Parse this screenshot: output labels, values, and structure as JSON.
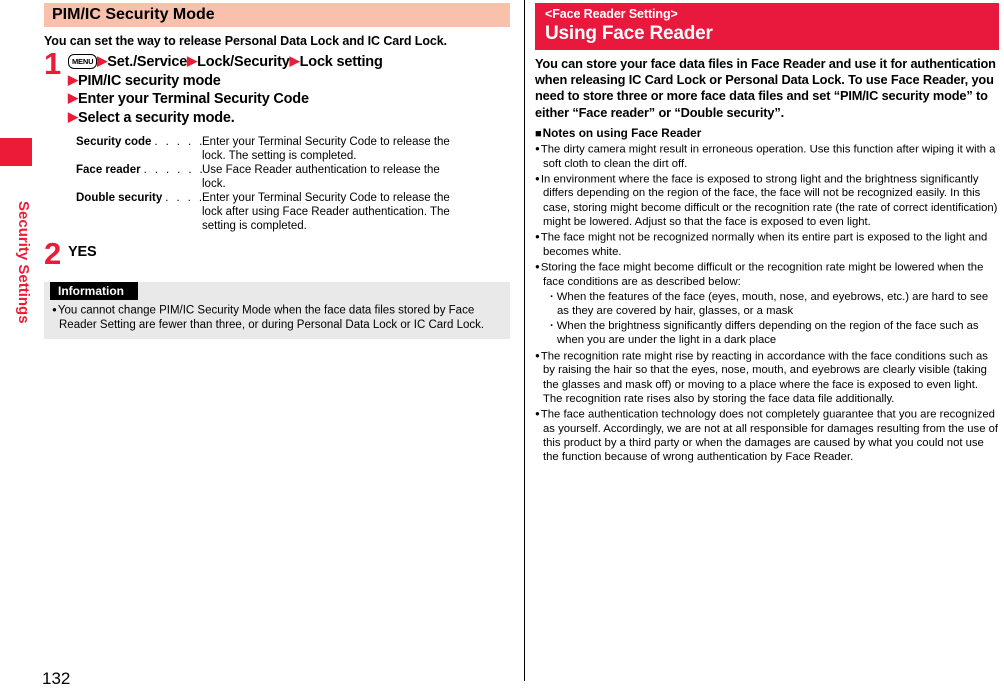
{
  "page": {
    "number": "132",
    "side_tab_label": "Security Settings",
    "accent_red": "#ec1c38",
    "header_red": "#e8193c",
    "header_peach": "#f9c0ab",
    "info_gray": "#e9e9e9"
  },
  "left": {
    "title": "PIM/IC Security Mode",
    "lead": "You can set the way to release Personal Data Lock and IC Card Lock.",
    "steps": [
      {
        "number": "1",
        "lines": [
          {
            "key_icon": "MENU",
            "segments": [
              "Set./Service",
              "Lock/Security",
              "Lock setting"
            ]
          },
          {
            "segments": [
              "PIM/IC security mode"
            ]
          },
          {
            "segments": [
              "Enter your Terminal Security Code"
            ]
          },
          {
            "segments": [
              "Select a security mode."
            ]
          }
        ]
      },
      {
        "number": "2",
        "lines": [
          {
            "segments_plain": "YES"
          }
        ]
      }
    ],
    "step2_label": "YES",
    "definitions": [
      {
        "term": "Security code",
        "dots": ". . . . .",
        "desc": "Enter your Terminal Security Code to release the lock. The setting is completed."
      },
      {
        "term": "Face reader",
        "dots": ". . . . . . .",
        "desc": "Use Face Reader authentication to release the lock."
      },
      {
        "term": "Double security",
        "dots": ". . . .",
        "desc": "Enter your Terminal Security Code to release the lock after using Face Reader authentication. The setting is completed."
      }
    ],
    "information": {
      "tag": "Information",
      "items": [
        "You cannot change PIM/IC Security Mode when the face data files stored by Face Reader Setting are fewer than three, or during Personal Data Lock or IC Card Lock."
      ]
    }
  },
  "right": {
    "eyebrow": "<Face Reader Setting>",
    "heading": "Using Face Reader",
    "lead": "You can store your face data files in Face Reader and use it for authentication when releasing IC Card Lock or Personal Data Lock. To use Face Reader, you need to store three or more face data files and set “PIM/IC security mode” to either “Face reader” or “Double security”.",
    "notes_heading": "Notes on using Face Reader",
    "notes": [
      {
        "type": "bullet",
        "text": "The dirty camera might result in erroneous operation. Use this function after wiping it with a soft cloth to clean the dirt off."
      },
      {
        "type": "bullet",
        "text": "In environment where the face is exposed to strong light and the brightness significantly differs depending on the region of the face, the face will not be recognized easily. In this case, storing might become difficult or the recognition rate (the rate of correct identification) might be lowered. Adjust so that the face is exposed to even light."
      },
      {
        "type": "bullet",
        "text": "The face might not be recognized normally when its entire part is exposed to the light and becomes white."
      },
      {
        "type": "bullet",
        "text": "Storing the face might become difficult or the recognition rate might be lowered when the face conditions are as described below:"
      },
      {
        "type": "sub",
        "text": "When the features of the face (eyes, mouth, nose, and eyebrows, etc.) are hard to see as they are covered by hair, glasses, or a mask"
      },
      {
        "type": "sub",
        "text": "When the brightness significantly differs depending on the region of the face such as when you are under the light in a dark place"
      },
      {
        "type": "bullet",
        "text": "The recognition rate might rise by reacting in accordance with the face conditions such as by raising the hair so that the eyes, nose, mouth, and eyebrows are clearly visible (taking the glasses and mask off) or moving to a place where the face is exposed to even light. The recognition rate rises also by storing the face data file additionally."
      },
      {
        "type": "bullet",
        "text": "The face authentication technology does not completely guarantee that you are recognized as yourself. Accordingly, we are not at all responsible for damages resulting from the use of this product by a third party or when the damages are caused by what you could not use the function because of wrong authentication by Face Reader."
      }
    ]
  }
}
